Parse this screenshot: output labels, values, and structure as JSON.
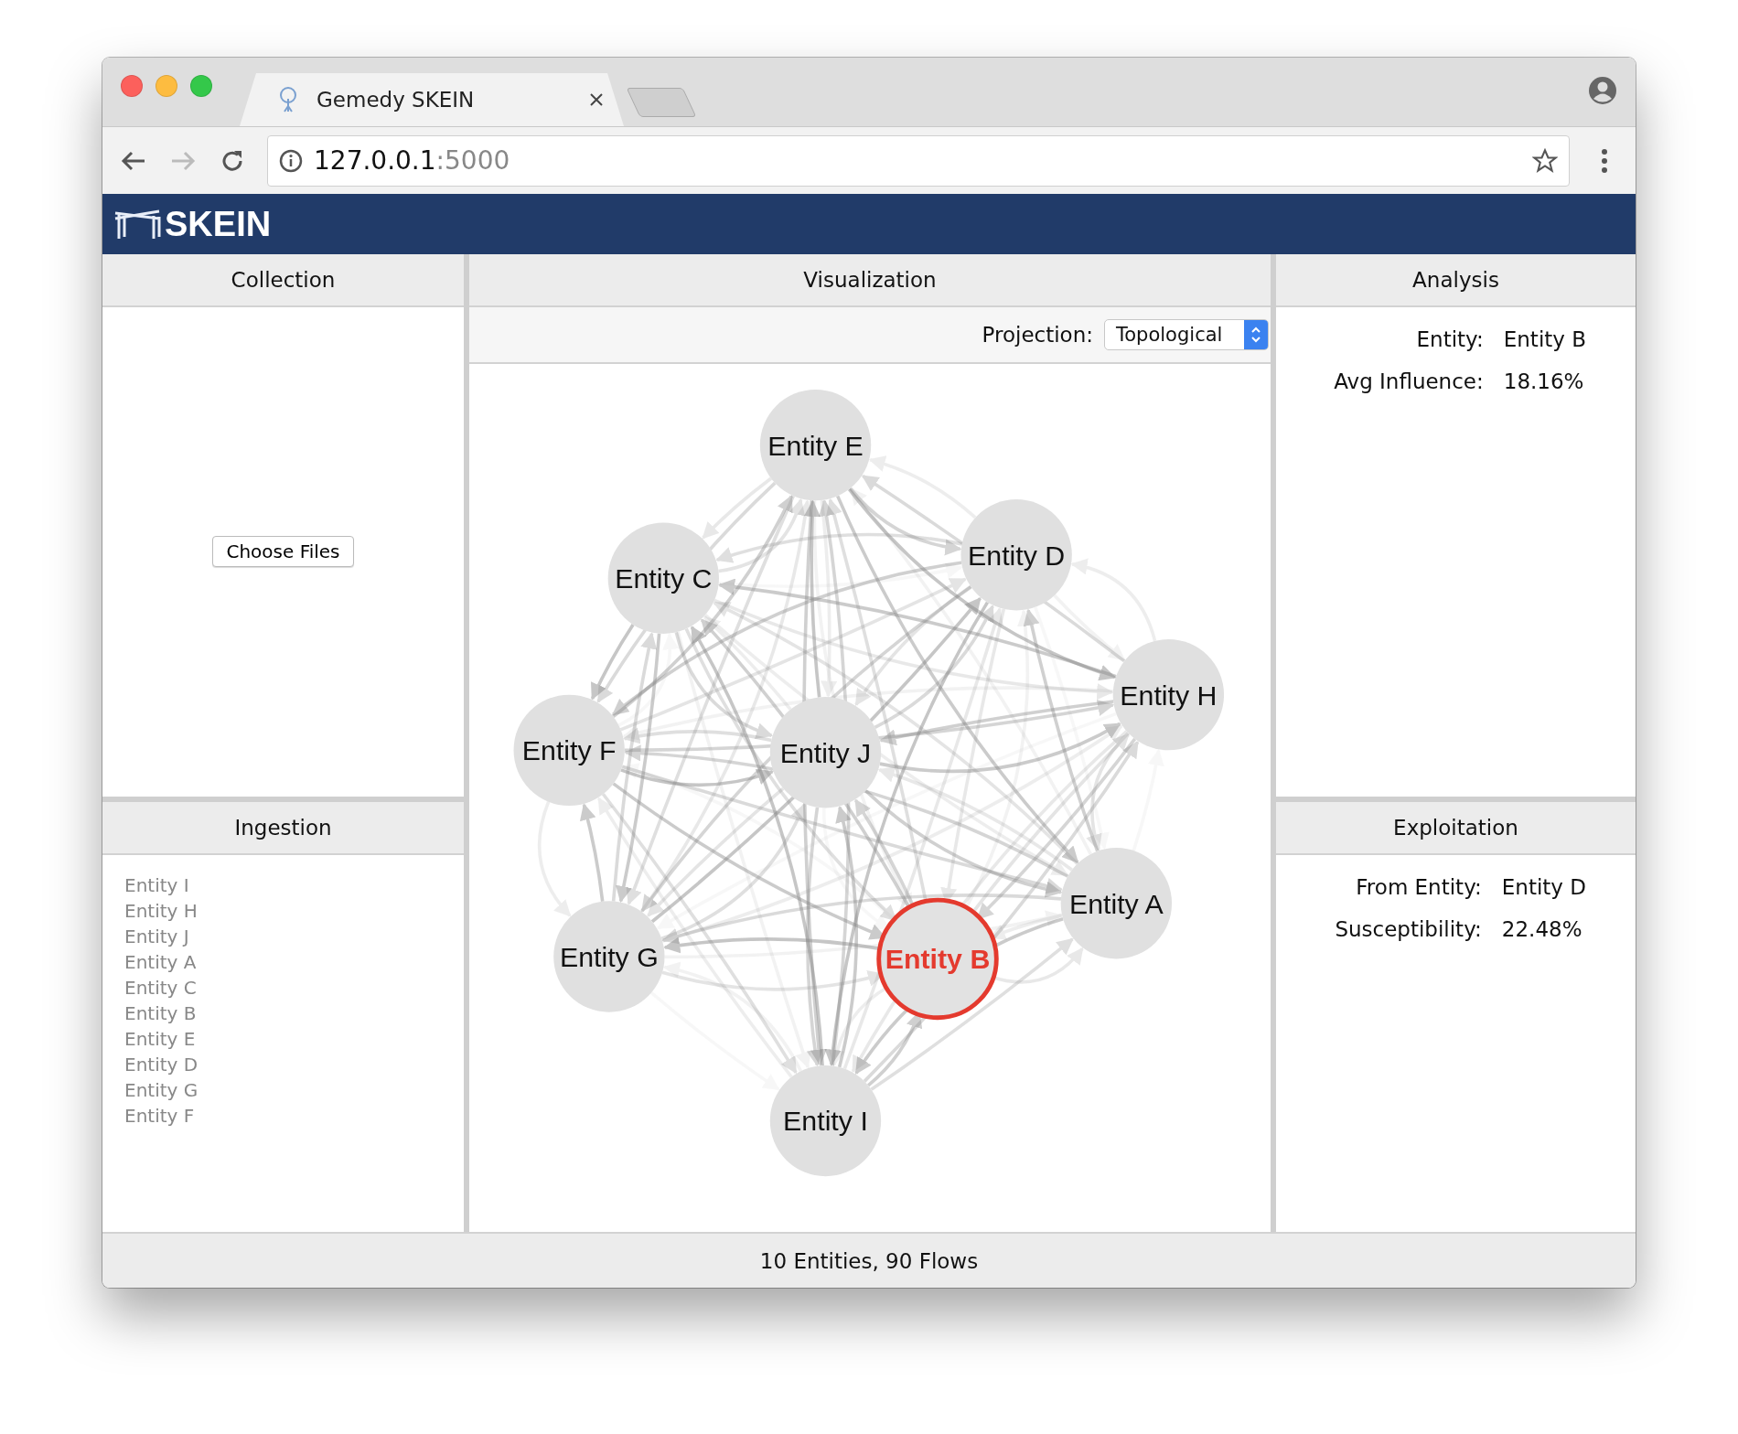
{
  "browser": {
    "tab_title": "Gemedy SKEIN",
    "url_host": "127.0.0.1",
    "url_port": ":5000"
  },
  "app": {
    "logo_text": "SKEIN"
  },
  "collection": {
    "title": "Collection",
    "button": "Choose Files"
  },
  "ingestion": {
    "title": "Ingestion",
    "items": [
      "Entity I",
      "Entity H",
      "Entity J",
      "Entity A",
      "Entity C",
      "Entity B",
      "Entity E",
      "Entity D",
      "Entity G",
      "Entity F"
    ]
  },
  "visualization": {
    "title": "Visualization",
    "projection_label": "Projection:",
    "projection_value": "Topological",
    "nodes": [
      {
        "label": "Entity E",
        "selected": false
      },
      {
        "label": "Entity D",
        "selected": false
      },
      {
        "label": "Entity C",
        "selected": false
      },
      {
        "label": "Entity H",
        "selected": false
      },
      {
        "label": "Entity F",
        "selected": false
      },
      {
        "label": "Entity J",
        "selected": false
      },
      {
        "label": "Entity A",
        "selected": false
      },
      {
        "label": "Entity G",
        "selected": false
      },
      {
        "label": "Entity B",
        "selected": true
      },
      {
        "label": "Entity I",
        "selected": false
      }
    ]
  },
  "analysis": {
    "title": "Analysis",
    "fields": [
      {
        "label": "Entity:",
        "value": "Entity B"
      },
      {
        "label": "Avg Influence:",
        "value": "18.16%"
      }
    ]
  },
  "exploitation": {
    "title": "Exploitation",
    "fields": [
      {
        "label": "From Entity:",
        "value": "Entity D"
      },
      {
        "label": "Susceptibility:",
        "value": "22.48%"
      }
    ]
  },
  "status_bar": "10 Entities, 90 Flows"
}
